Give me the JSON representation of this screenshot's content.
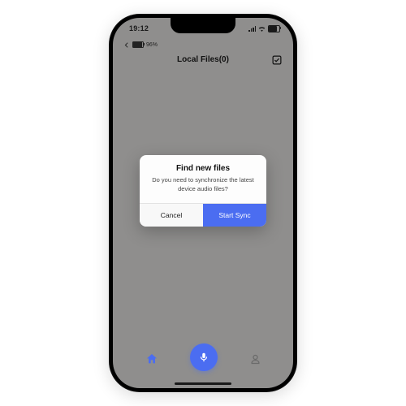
{
  "status": {
    "time": "19:12",
    "wifi": true
  },
  "secondary": {
    "battery_pct": "96%"
  },
  "header": {
    "title": "Local Files(0)"
  },
  "dialog": {
    "title": "Find new files",
    "message": "Do you need to synchronize the latest device audio files?",
    "cancel": "Cancel",
    "confirm": "Start Sync"
  },
  "colors": {
    "primary": "#4b6df1"
  }
}
